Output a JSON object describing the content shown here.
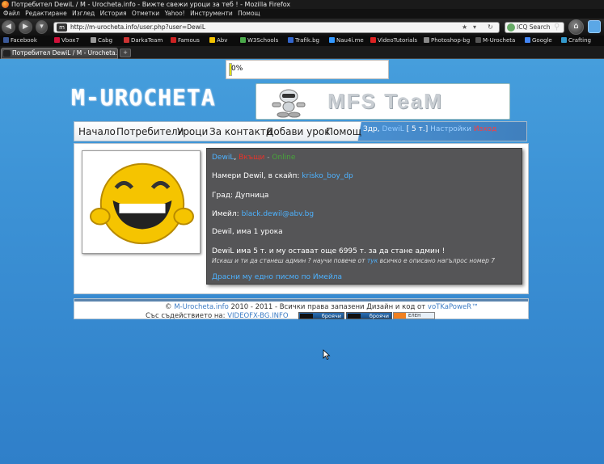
{
  "browser": {
    "title": "Потребител DewiL / M - Urocheta.info - Вижте свежи уроци за теб ! - Mozilla Firefox",
    "menu": [
      "Файл",
      "Редактиране",
      "Изглед",
      "История",
      "Отметки",
      "Yahoo!",
      "Инструменти",
      "Помощ"
    ],
    "url": "http://m-urocheta.info/user.php?user=DewiL",
    "search_placeholder": "ICQ Search",
    "bookmarks": [
      {
        "label": "Facebook",
        "color": "#3b5998"
      },
      {
        "label": "Vbox7",
        "color": "#d0103a"
      },
      {
        "label": "Cabg",
        "color": "#999999"
      },
      {
        "label": "DarkaTeam",
        "color": "#cc3333"
      },
      {
        "label": "Famous",
        "color": "#cc2222"
      },
      {
        "label": "Abv",
        "color": "#f2c200"
      },
      {
        "label": "W3Schools",
        "color": "#4aa84a"
      },
      {
        "label": "Trafik.bg",
        "color": "#3366cc"
      },
      {
        "label": "Nau4i.me",
        "color": "#3399ff"
      },
      {
        "label": "VideoTutorials",
        "color": "#dd2222"
      },
      {
        "label": "Photoshop-bg",
        "color": "#888888"
      },
      {
        "label": "M-Urocheta",
        "color": "#555555"
      },
      {
        "label": "Google",
        "color": "#4285f4"
      },
      {
        "label": "Crafting",
        "color": "#3399cc"
      }
    ],
    "tab_label": "Потребител DewiL / M - Urocheta.in...",
    "new_tab_label": "+"
  },
  "loading": {
    "text": "0%",
    "progress": 0.02
  },
  "site": {
    "logo": "M-UROCHETA",
    "banner_text": "MFS TeaM"
  },
  "nav": {
    "links": [
      "Начало",
      "Потребители",
      "Уроци",
      "За контакти",
      "Добави урок",
      "Помощ"
    ],
    "greeting": "Здр,",
    "user_name": "DewiL",
    "points": "[ 5 т.]",
    "settings": "Настройки",
    "logout": "Изход"
  },
  "profile": {
    "name": "DewiL",
    "sep1": ",",
    "status_offline": "Вкъщи",
    "sep2": " - ",
    "status_online": "Online",
    "skype_label": "Намери Dewil, в скайп:",
    "skype": "krisko_boy_dp",
    "city": "Град: Дупница",
    "email_label": "Имейл:",
    "email": "black.dewil@abv.bg",
    "lessons": "Dewil, има 1 урока",
    "points_line": "DewiL има 5 т. и му остават още 6995 т. за да стане админ !",
    "admin_hint_a": "Искаш и ти да станеш админ ? научи повече от",
    "admin_hint_link": "тук",
    "admin_hint_b": "всичко е описано нагълрос номер 7",
    "send_mail": "Драсни му едно писмо по Имейла"
  },
  "footer": {
    "copy_prefix": "©",
    "site_link": "M-Urocheta.info",
    "years": "2010 - 2011 - Всички права запазени Дизайн и код от",
    "author": "voTKaPoweR™",
    "partner_label": "Със съдействието на:",
    "partner": "VIDEOFX-BG.INFO",
    "counter1": "броячи",
    "counter2": "броячи",
    "counter3": "ЕЛЕН"
  }
}
